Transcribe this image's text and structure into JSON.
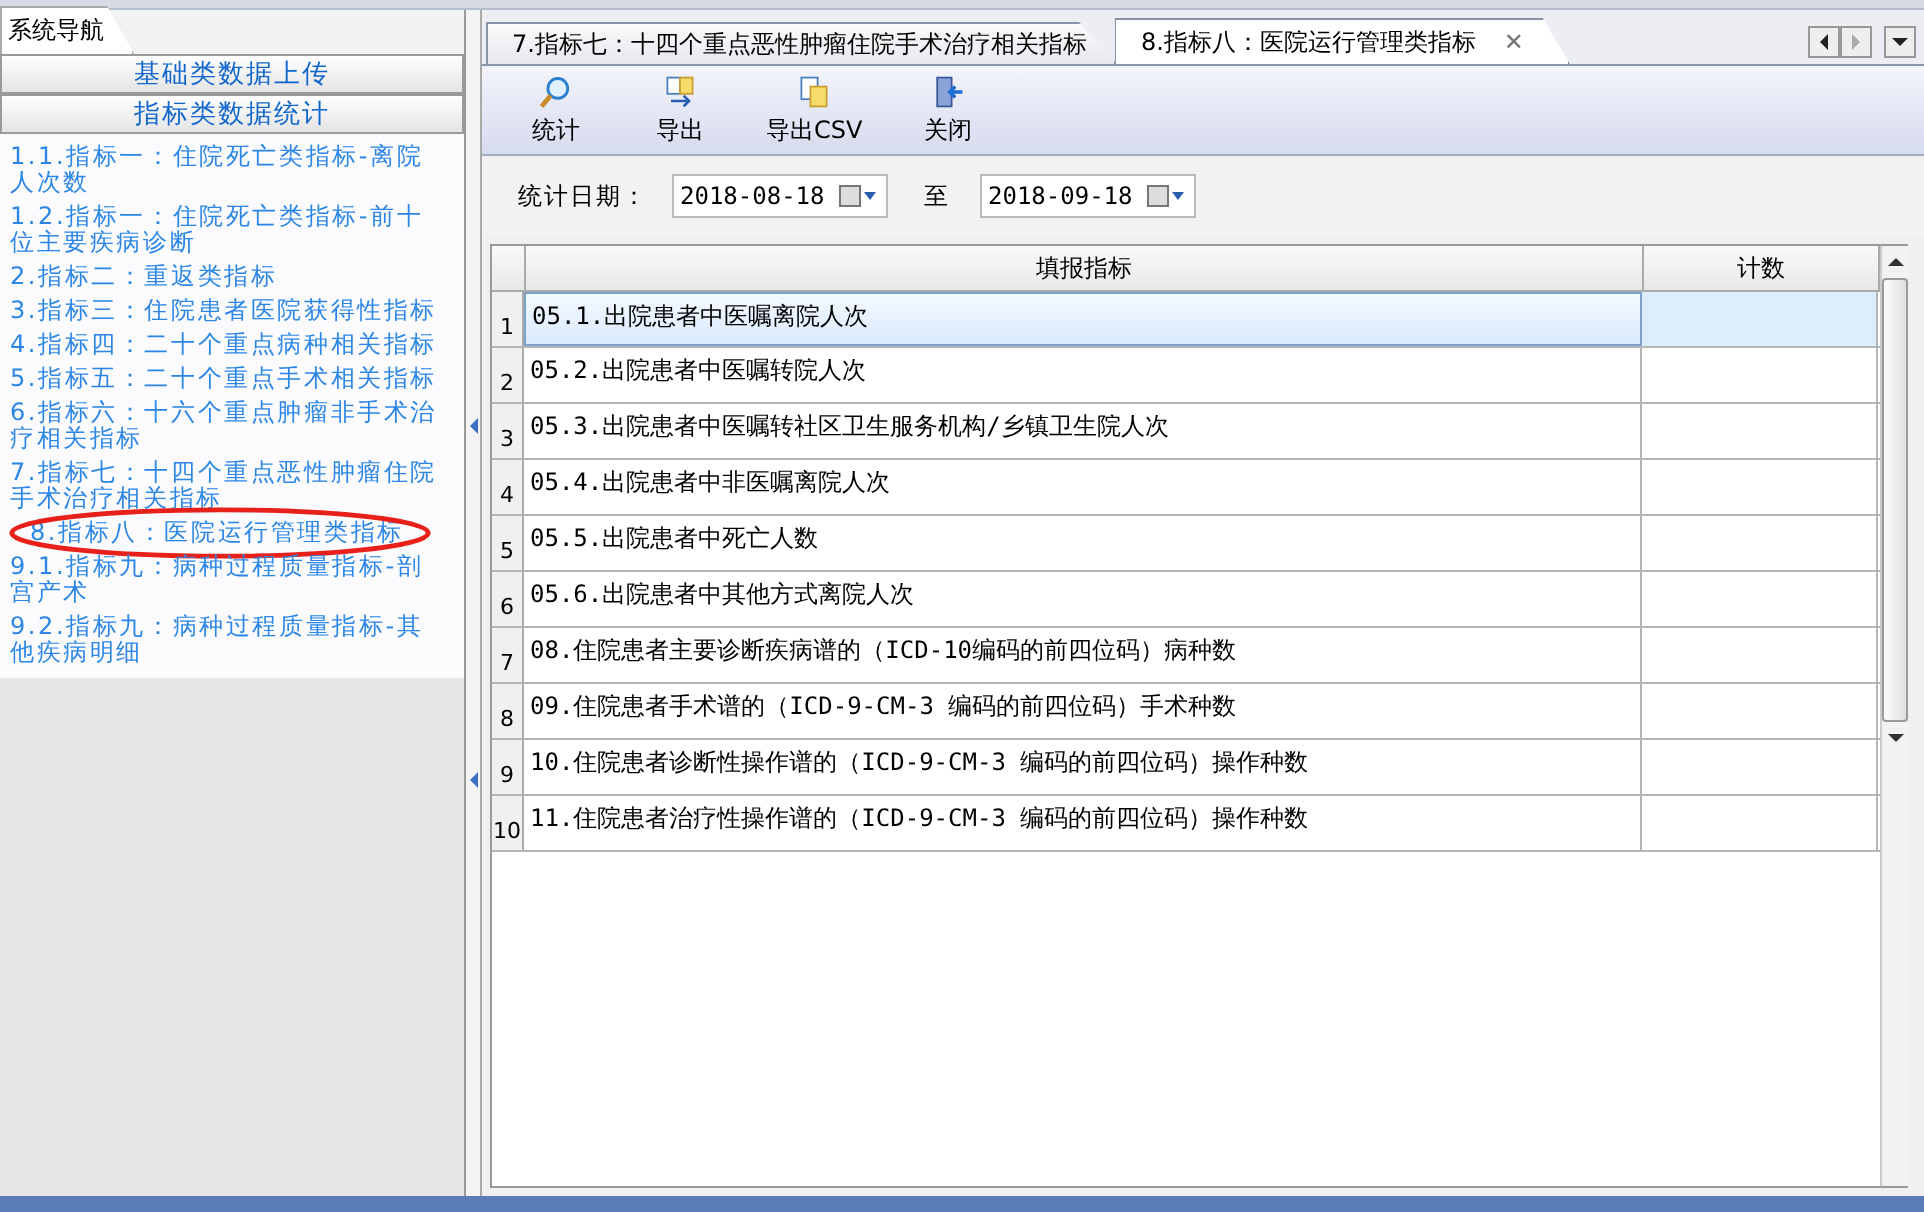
{
  "nav": {
    "title": "系统导航",
    "sections": [
      {
        "label": "基础类数据上传"
      },
      {
        "label": "指标类数据统计"
      }
    ],
    "items": [
      {
        "label": "1.1.指标一：住院死亡类指标-离院人次数",
        "circled": false
      },
      {
        "label": "1.2.指标一：住院死亡类指标-前十位主要疾病诊断",
        "circled": false
      },
      {
        "label": "2.指标二：重返类指标",
        "circled": false
      },
      {
        "label": "3.指标三：住院患者医院获得性指标",
        "circled": false
      },
      {
        "label": "4.指标四：二十个重点病种相关指标",
        "circled": false
      },
      {
        "label": "5.指标五：二十个重点手术相关指标",
        "circled": false
      },
      {
        "label": "6.指标六：十六个重点肿瘤非手术治疗相关指标",
        "circled": false
      },
      {
        "label": "7.指标七：十四个重点恶性肿瘤住院手术治疗相关指标",
        "circled": false
      },
      {
        "label": "8.指标八：医院运行管理类指标",
        "circled": true
      },
      {
        "label": "9.1.指标九：病种过程质量指标-剖宫产术",
        "circled": false
      },
      {
        "label": "9.2.指标九：病种过程质量指标-其他疾病明细",
        "circled": false
      }
    ]
  },
  "tabs": [
    {
      "label": "7.指标七：十四个重点恶性肿瘤住院手术治疗相关指标",
      "selected": false
    },
    {
      "label": "8.指标八：医院运行管理类指标",
      "selected": true
    }
  ],
  "close_glyph": "✕",
  "toolbar": [
    {
      "label": "统计",
      "kind": "search"
    },
    {
      "label": "导出",
      "kind": "export"
    },
    {
      "label": "导出CSV",
      "kind": "csv"
    },
    {
      "label": "关闭",
      "kind": "close"
    }
  ],
  "filter": {
    "label": "统计日期：",
    "from": "2018-08-18",
    "separator": "至",
    "to": "2018-09-18"
  },
  "table": {
    "columns": [
      "填报指标",
      "计数"
    ],
    "rows": [
      {
        "number": "1",
        "indicator": "05.1.出院患者中医嘱离院人次",
        "selected": true
      },
      {
        "number": "2",
        "indicator": "05.2.出院患者中医嘱转院人次",
        "selected": false
      },
      {
        "number": "3",
        "indicator": "05.3.出院患者中医嘱转社区卫生服务机构/乡镇卫生院人次",
        "selected": false
      },
      {
        "number": "4",
        "indicator": "05.4.出院患者中非医嘱离院人次",
        "selected": false
      },
      {
        "number": "5",
        "indicator": "05.5.出院患者中死亡人数",
        "selected": false
      },
      {
        "number": "6",
        "indicator": "05.6.出院患者中其他方式离院人次",
        "selected": false
      },
      {
        "number": "7",
        "indicator": "08.住院患者主要诊断疾病谱的（ICD-10编码的前四位码）病种数",
        "selected": false
      },
      {
        "number": "8",
        "indicator": "09.住院患者手术谱的（ICD-9-CM-3 编码的前四位码）手术种数",
        "selected": false
      },
      {
        "number": "9",
        "indicator": "10.住院患者诊断性操作谱的（ICD-9-CM-3 编码的前四位码）操作种数",
        "selected": false
      },
      {
        "number": "10",
        "indicator": "11.住院患者治疗性操作谱的（ICD-9-CM-3 编码的前四位码）操作种数",
        "selected": false
      }
    ]
  }
}
